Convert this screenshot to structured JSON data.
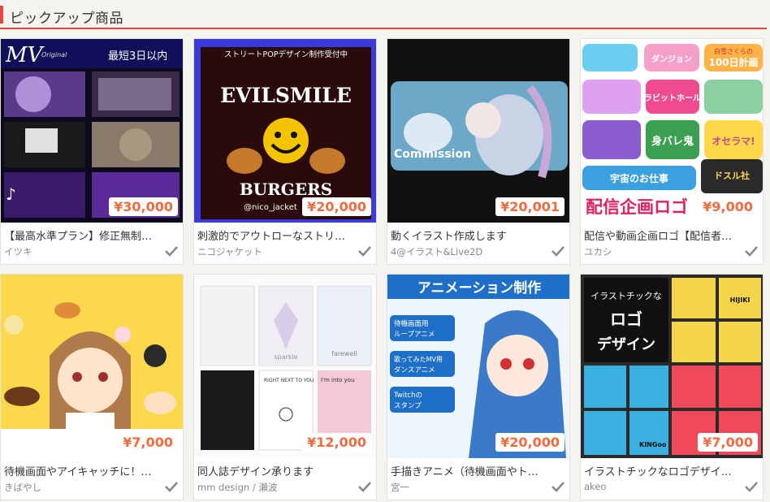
{
  "header": {
    "title": "ピックアップ商品"
  },
  "colors": {
    "accent": "#e3473f",
    "price": "#f06b3e",
    "bg": "#f4f3ef"
  },
  "products": [
    {
      "title": "【最高水準プラン】修正無制…",
      "seller": "イツキ",
      "price": "¥30,000",
      "thumb_text": {
        "a": "MV",
        "b": "Original",
        "c": "最短3日以内"
      }
    },
    {
      "title": "刺激的でアウトローなストリ…",
      "seller": "ニコジャケット",
      "price": "¥20,000",
      "thumb_text": {
        "a": "ストリートPOPデザイン制作受付中",
        "b": "EVILSMILE",
        "c": "BURGERS",
        "d": "@nico_jacket"
      }
    },
    {
      "title": "動くイラスト作成します",
      "seller": "4@イラスト&Live2D",
      "price": "¥20,001",
      "thumb_text": {
        "a": "Commission"
      }
    },
    {
      "title": "配信や動画企画ロゴ【配信者…",
      "seller": "ユカシ",
      "price": "¥9,000",
      "thumb_text": {
        "a": "配信企画ロゴ",
        "b": "ダンジョン",
        "c": "白雪さくらの",
        "d": "100日計画",
        "e": "ラビットホール",
        "f": "身バレ鬼",
        "g": "オセラマ!",
        "h": "宇宙のお仕事",
        "i": "ドスル社"
      }
    },
    {
      "title": "待機画面やアイキャッチに！…",
      "seller": "きばやし",
      "price": "¥7,000"
    },
    {
      "title": "同人誌デザイン承ります",
      "seller": "mm design / 瀬波",
      "price": "¥12,000",
      "thumb_text": {
        "a": "sparkle",
        "b": "farewell",
        "c": "RIGHT NEXT TO YOU",
        "d": "I'm into you"
      }
    },
    {
      "title": "手描きアニメ（待機画面やト…",
      "seller": "宮一",
      "price": "¥20,000",
      "thumb_text": {
        "a": "アニメーション制作",
        "b": "待機画面用 ループアニメ",
        "c": "歌ってみたMV用 ダンスアニメ",
        "d": "Twitchの スタンプ"
      }
    },
    {
      "title": "イラストチックなロゴデザイ…",
      "seller": "akeo",
      "price": "¥7,000",
      "thumb_text": {
        "a": "イラストチックな",
        "b": "ロゴ",
        "c": "デザイン",
        "d": "HIJIKI",
        "e": "KINGoo"
      }
    }
  ]
}
